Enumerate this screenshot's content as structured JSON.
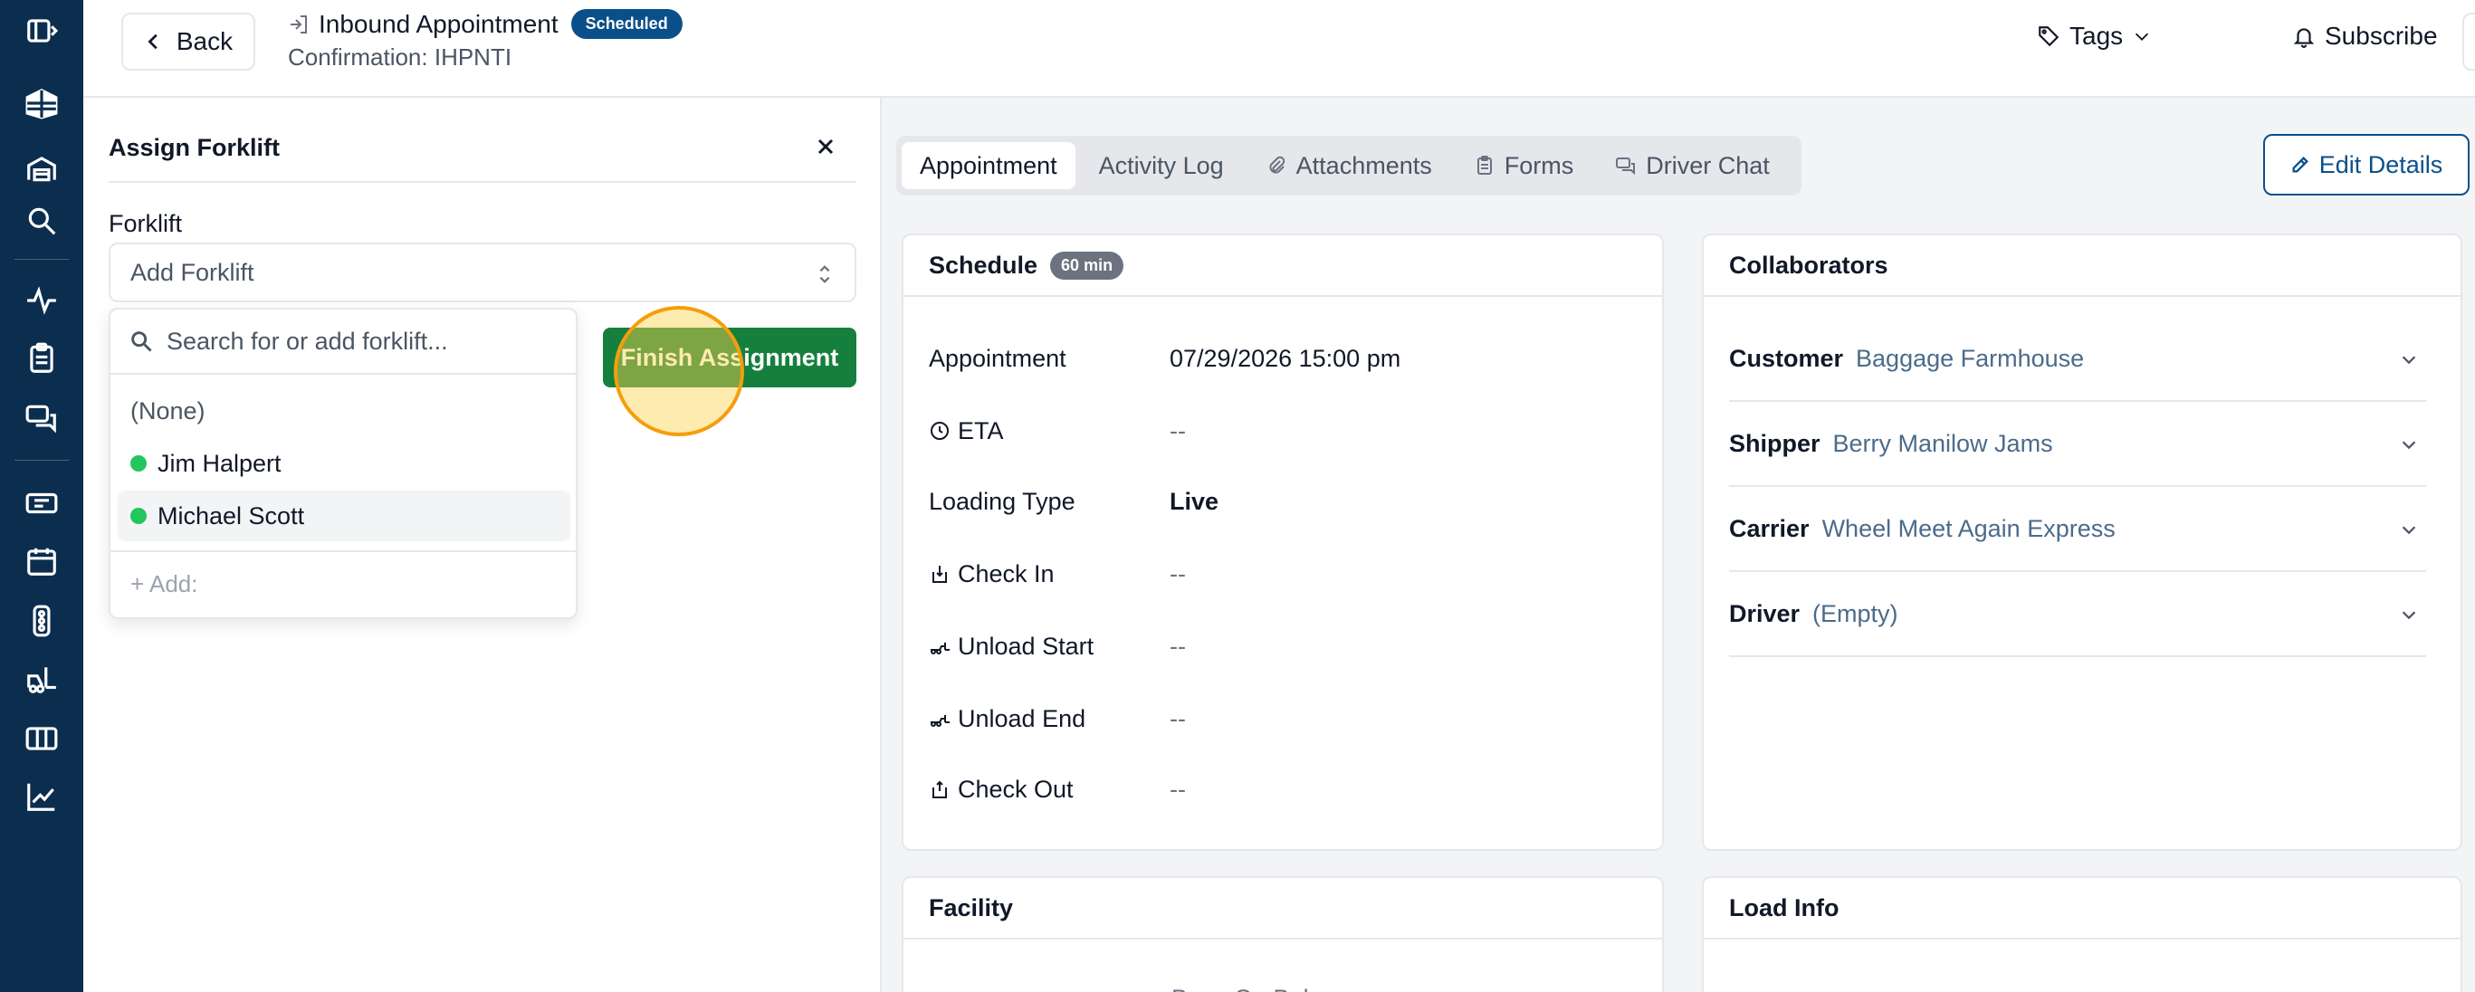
{
  "header": {
    "back_label": "Back",
    "appt_title": "Inbound Appointment",
    "status_badge": "Scheduled",
    "confirmation": "Confirmation: IHPNTI",
    "tags_label": "Tags",
    "subscribe_label": "Subscribe"
  },
  "sidebar": {
    "icons": [
      "sidebar-toggle-icon",
      "warehouse-logo-icon",
      "dock-icon",
      "search-icon",
      "activity-icon",
      "clipboard-icon",
      "chat-icon",
      "ticket-icon",
      "calendar-icon",
      "traffic-light-icon",
      "forklift-icon",
      "map-icon",
      "chart-icon"
    ]
  },
  "assign_panel": {
    "title": "Assign Forklift",
    "field_label": "Forklift",
    "select_placeholder": "Add Forklift",
    "search_placeholder": "Search for or add forklift...",
    "options": [
      {
        "label": "(None)",
        "status_color": ""
      },
      {
        "label": "Jim Halpert",
        "status_color": "#22c55e"
      },
      {
        "label": "Michael Scott",
        "status_color": "#22c55e"
      }
    ],
    "add_label": "+ Add:",
    "finish_button": "Finish Assignment"
  },
  "tabs": [
    {
      "label": "Appointment",
      "active": true,
      "icon": ""
    },
    {
      "label": "Activity Log",
      "active": false,
      "icon": ""
    },
    {
      "label": "Attachments",
      "active": false,
      "icon": "paperclip-icon"
    },
    {
      "label": "Forms",
      "active": false,
      "icon": "clipboard-icon"
    },
    {
      "label": "Driver Chat",
      "active": false,
      "icon": "chat-icon"
    }
  ],
  "edit_button": "Edit Details",
  "schedule": {
    "title": "Schedule",
    "duration": "60 min",
    "rows": [
      {
        "label": "Appointment",
        "value": "07/29/2026 15:00 pm",
        "icon": ""
      },
      {
        "label": "ETA",
        "value": "--",
        "icon": "clock-icon"
      },
      {
        "label": "Loading Type",
        "value": "Live",
        "icon": ""
      },
      {
        "label": "Check In",
        "value": "--",
        "icon": "check-in-icon"
      },
      {
        "label": "Unload Start",
        "value": "--",
        "icon": "forklift-icon"
      },
      {
        "label": "Unload End",
        "value": "--",
        "icon": "forklift-icon"
      },
      {
        "label": "Check Out",
        "value": "--",
        "icon": "check-out-icon"
      }
    ]
  },
  "collaborators": {
    "title": "Collaborators",
    "rows": [
      {
        "key": "Customer",
        "value": "Baggage Farmhouse"
      },
      {
        "key": "Shipper",
        "value": "Berry Manilow Jams"
      },
      {
        "key": "Carrier",
        "value": "Wheel Meet Again Express"
      },
      {
        "key": "Driver",
        "value": "(Empty)"
      }
    ]
  },
  "facility": {
    "title": "Facility",
    "partial_value": "Bees On Bales"
  },
  "load_info": {
    "title": "Load Info"
  },
  "colors": {
    "brand": "#0b2e4f",
    "accent": "#0b4f8a",
    "success": "#15803d",
    "available": "#22c55e"
  }
}
